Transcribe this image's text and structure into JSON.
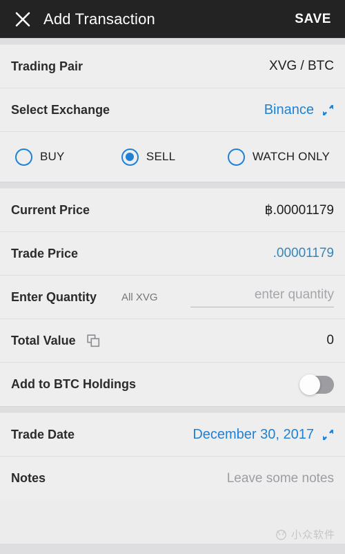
{
  "header": {
    "close_icon": "close-icon",
    "title": "Add Transaction",
    "save_label": "SAVE"
  },
  "form": {
    "trading_pair": {
      "label": "Trading Pair",
      "value": "XVG / BTC"
    },
    "select_exchange": {
      "label": "Select Exchange",
      "value": "Binance",
      "icon": "expand-icon"
    },
    "transaction_type": {
      "options": [
        {
          "label": "BUY",
          "selected": false
        },
        {
          "label": "SELL",
          "selected": true
        },
        {
          "label": "WATCH ONLY",
          "selected": false
        }
      ]
    },
    "current_price": {
      "label": "Current Price",
      "value": "฿.00001179"
    },
    "trade_price": {
      "label": "Trade Price",
      "value": ".00001179"
    },
    "enter_quantity": {
      "label": "Enter Quantity",
      "all_label": "All XVG",
      "value": "",
      "placeholder": "enter quantity"
    },
    "total_value": {
      "label": "Total Value",
      "icon": "copy-icon",
      "value": "0"
    },
    "add_to_holdings": {
      "label": "Add to BTC Holdings",
      "toggle_on": false
    },
    "trade_date": {
      "label": "Trade Date",
      "value": "December 30, 2017",
      "icon": "expand-icon"
    },
    "notes": {
      "label": "Notes",
      "value": "",
      "placeholder": "Leave some notes"
    }
  },
  "watermark": {
    "text": "小众软件"
  },
  "colors": {
    "header_bg": "#232323",
    "accent_blue": "#2081d4",
    "trade_price_blue": "#3586b8",
    "row_bg": "#eeeeef",
    "separator": "#dedee0"
  }
}
